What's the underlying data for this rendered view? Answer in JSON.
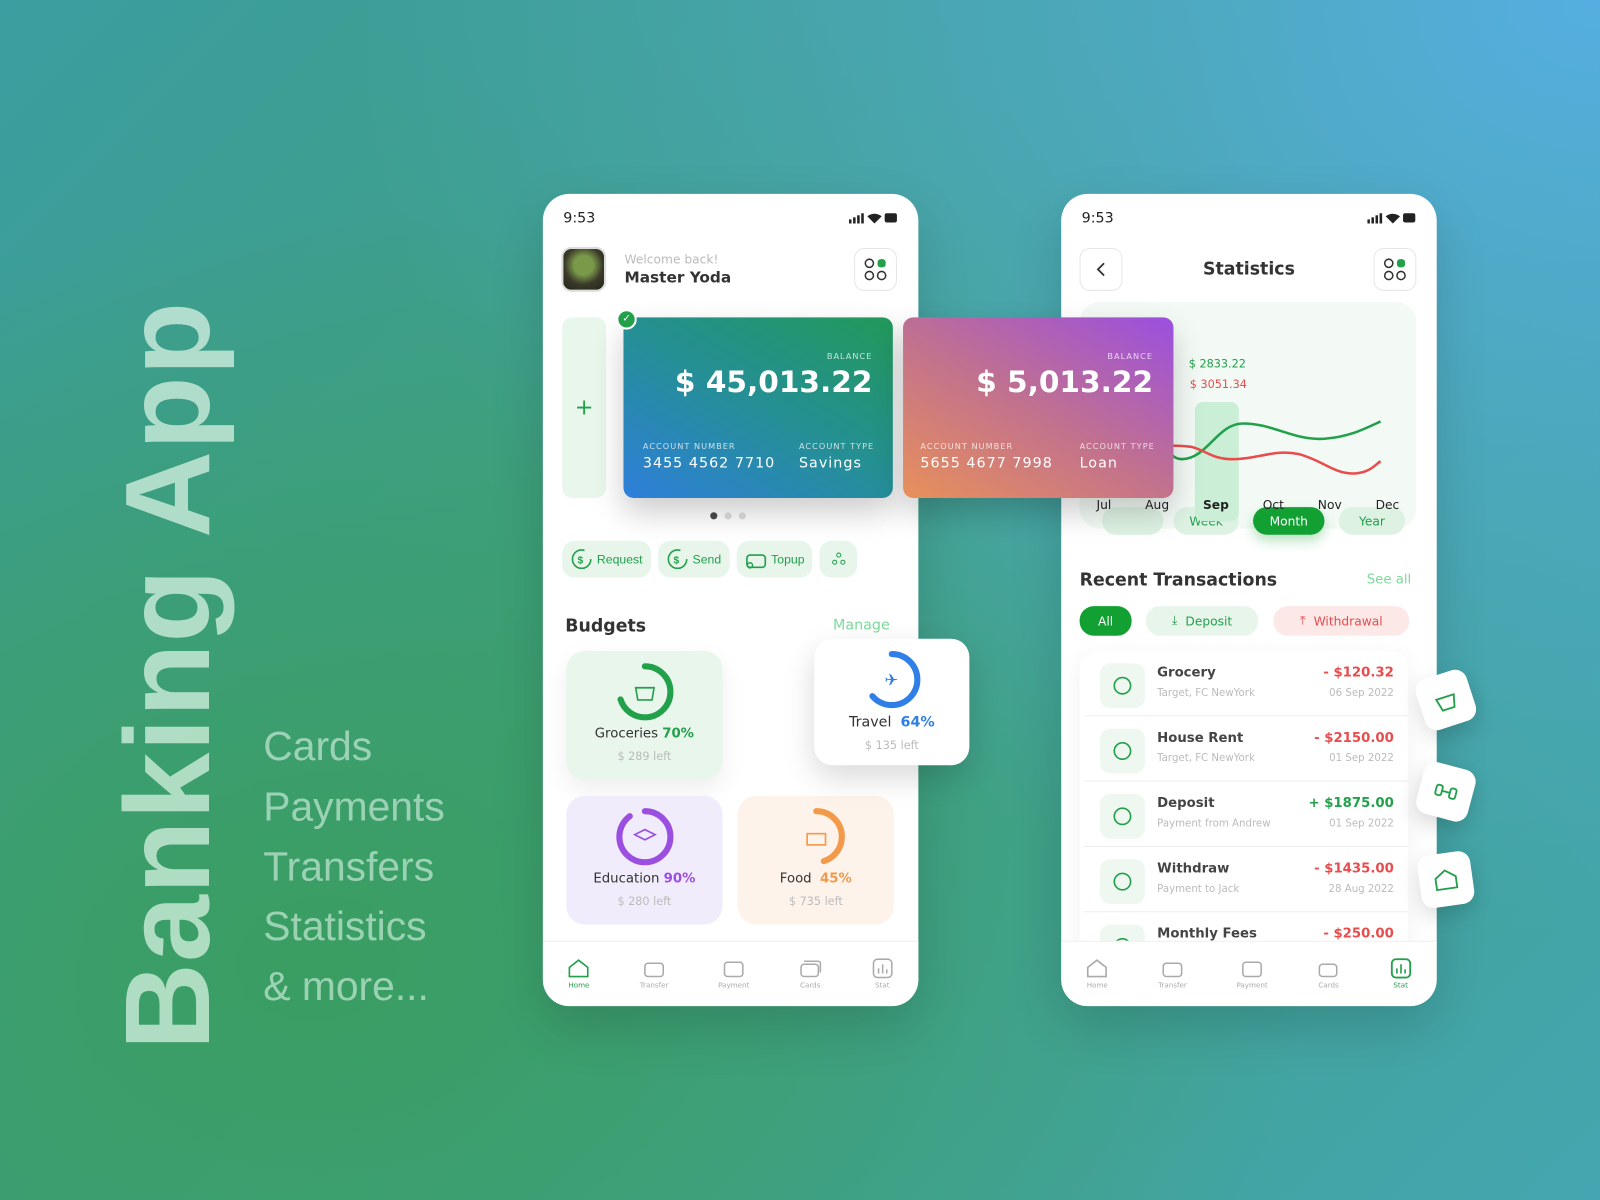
{
  "hero": {
    "title": "Banking App",
    "features": [
      "Cards",
      "Payments",
      "Transfers",
      "Statistics",
      "& more..."
    ]
  },
  "colors": {
    "accent": "#12a033",
    "negative": "#e84c4c",
    "education": "#9b4fe0",
    "food": "#f2994a",
    "travel": "#2f7fe6"
  },
  "home": {
    "time": "9:53",
    "welcome": "Welcome back!",
    "user": "Master Yoda",
    "add_card": "+",
    "cards": [
      {
        "balance_label": "BALANCE",
        "balance": "$ 45,013.22",
        "acct_label": "ACCOUNT NUMBER",
        "acct": "3455 4562 7710",
        "type_label": "ACCOUNT TYPE",
        "type": "Savings"
      },
      {
        "balance_label": "BALANCE",
        "balance": "$ 5,013.22",
        "acct_label": "ACCOUNT NUMBER",
        "acct": "5655 4677 7998",
        "type_label": "ACCOUNT TYPE",
        "type": "Loan"
      }
    ],
    "actions": [
      {
        "label": "Request",
        "icon": "dollar-in-icon"
      },
      {
        "label": "Send",
        "icon": "dollar-out-icon"
      },
      {
        "label": "Topup",
        "icon": "wallet-icon"
      },
      {
        "label": "",
        "icon": "more-icon"
      }
    ],
    "budgets_title": "Budgets",
    "manage": "Manage",
    "budgets": [
      {
        "name": "Groceries",
        "percent": "70%",
        "value": 70,
        "left": "$ 289 left",
        "icon": "basket-icon"
      },
      {
        "name": "Travel",
        "percent": "64%",
        "value": 64,
        "left": "$ 135 left",
        "icon": "plane-icon"
      },
      {
        "name": "Education",
        "percent": "90%",
        "value": 90,
        "left": "$ 280 left",
        "icon": "graduation-cap-icon"
      },
      {
        "name": "Food",
        "percent": "45%",
        "value": 45,
        "left": "$ 735 left",
        "icon": "cake-icon"
      }
    ]
  },
  "nav": [
    "Home",
    "Transfer",
    "Payment",
    "Cards",
    "Stat"
  ],
  "stats": {
    "time": "9:53",
    "title": "Statistics",
    "periods": [
      "Week",
      "Month",
      "Year"
    ],
    "active_period": "Month",
    "tooltip_income": "$ 2833.22",
    "tooltip_expense": "$ 3051.34",
    "months": [
      "Jul",
      "Aug",
      "Sep",
      "Oct",
      "Nov",
      "Dec"
    ],
    "selected_month": "Sep",
    "recent_title": "Recent Transactions",
    "see_all": "See all",
    "filters": [
      "All",
      "Deposit",
      "Withdrawal"
    ],
    "transactions": [
      {
        "name": "Grocery",
        "sub": "Target, FC NewYork",
        "amount": "-  $120.32",
        "date": "06 Sep 2022",
        "type": "debit"
      },
      {
        "name": "House Rent",
        "sub": "Target, FC NewYork",
        "amount": "- $2150.00",
        "date": "01 Sep 2022",
        "type": "debit"
      },
      {
        "name": "Deposit",
        "sub": "Payment from Andrew",
        "amount": "+ $1875.00",
        "date": "01 Sep 2022",
        "type": "credit"
      },
      {
        "name": "Withdraw",
        "sub": "Payment to Jack",
        "amount": "- $1435.00",
        "date": "28 Aug 2022",
        "type": "debit"
      },
      {
        "name": "Monthly Fees",
        "sub": "",
        "amount": "- $250.00",
        "date": "",
        "type": "debit"
      }
    ]
  }
}
